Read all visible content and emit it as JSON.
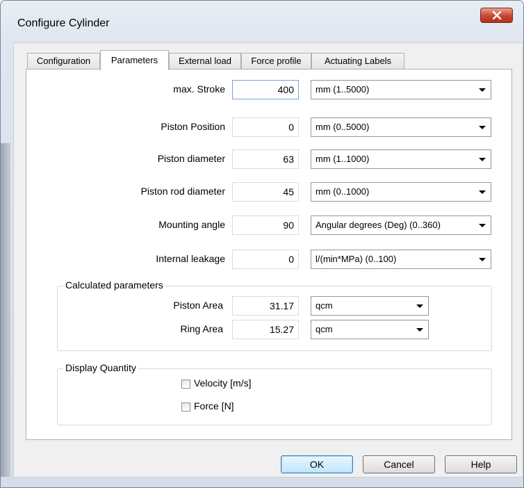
{
  "window": {
    "title": "Configure Cylinder",
    "close_symbol": "x"
  },
  "tabs": [
    {
      "label": "Configuration"
    },
    {
      "label": "Parameters"
    },
    {
      "label": "External load"
    },
    {
      "label": "Force profile"
    },
    {
      "label": "Actuating Labels"
    }
  ],
  "active_tab": "Parameters",
  "parameters": [
    {
      "label": "max. Stroke",
      "value": "400",
      "unit": "mm  (1..5000)"
    },
    {
      "label": "Piston Position",
      "value": "0",
      "unit": "mm  (0..5000)"
    },
    {
      "label": "Piston diameter",
      "value": "63",
      "unit": "mm  (1..1000)"
    },
    {
      "label": "Piston rod diameter",
      "value": "45",
      "unit": "mm  (0..1000)"
    },
    {
      "label": "Mounting angle",
      "value": "90",
      "unit": "Angular degrees (Deg)  (0..360)"
    },
    {
      "label": "Internal leakage",
      "value": "0",
      "unit": "l/(min*MPa)  (0..100)"
    }
  ],
  "calculated": {
    "title": "Calculated parameters",
    "rows": [
      {
        "label": "Piston Area",
        "value": "31.17",
        "unit": "qcm"
      },
      {
        "label": "Ring Area",
        "value": "15.27",
        "unit": "qcm"
      }
    ]
  },
  "display": {
    "title": "Display Quantity",
    "items": [
      {
        "label": "Velocity [m/s]",
        "checked": false
      },
      {
        "label": "Force [N]",
        "checked": false
      }
    ]
  },
  "buttons": {
    "ok": "OK",
    "cancel": "Cancel",
    "help": "Help"
  }
}
